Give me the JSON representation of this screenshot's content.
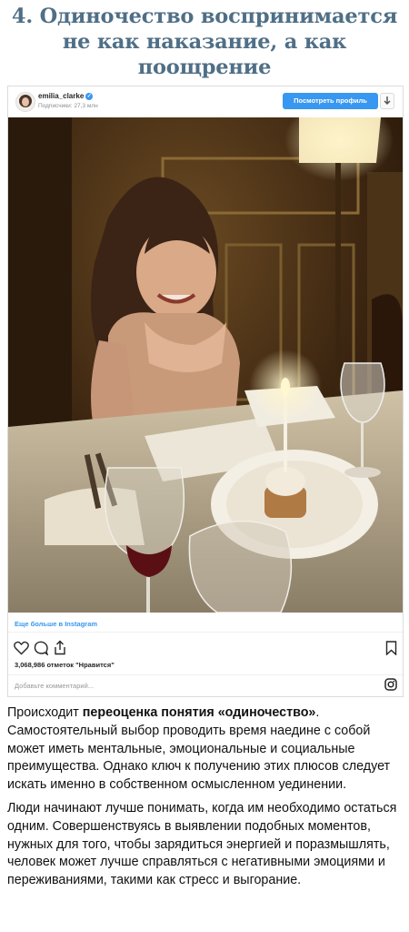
{
  "heading": {
    "line1": "4. Одиночество воспринимается",
    "line2": "не как наказание, а как",
    "line3": "поощрение"
  },
  "post": {
    "username": "emilia_clarke",
    "followers": "Подписчики: 27,3 млн",
    "view_profile_label": "Посмотреть профиль",
    "more_link": "Еще больше в Instagram",
    "likes": "3,068,986 отметок \"Нравится\"",
    "comment_placeholder": "Добавьте комментарий...",
    "icons": [
      "heart-icon",
      "comment-icon",
      "share-icon",
      "bookmark-icon",
      "instagram-icon",
      "verified-icon",
      "download-icon"
    ]
  },
  "article": {
    "p1_lead": "Происходит ",
    "p1_bold": "переоценка понятия «одиночество»",
    "p1_rest": ". Самостоятельный выбор проводить время наедине с собой может иметь ментальные, эмоциональные и социальные преимущества. Однако ключ к получению этих плюсов следует искать именно в собственном осмысленном уединении.",
    "p2": "Люди начинают лучше понимать, когда им необходимо остаться одним. Совершенствуясь в выявлении подобных моментов, нужных для того, чтобы зарядиться энергией и поразмышлять, человек может лучше справляться с негативными эмоциями и переживаниями, такими как стресс и выгорание."
  },
  "colors": {
    "heading": "#4f6f86",
    "accent": "#3897f0"
  }
}
